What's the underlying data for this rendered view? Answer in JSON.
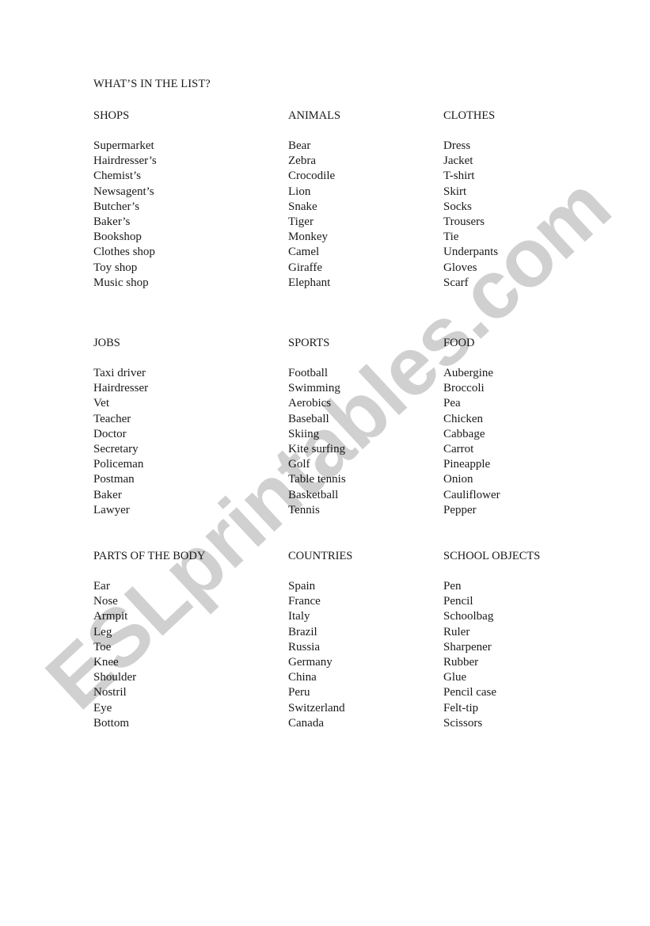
{
  "document": {
    "title": "WHAT’S IN THE LIST?",
    "watermark": "ESLprintables.com",
    "sections": [
      {
        "heading": "SHOPS",
        "items": [
          "Supermarket",
          "Hairdresser’s",
          "Chemist’s",
          "Newsagent’s",
          "Butcher’s",
          "Baker’s",
          "Bookshop",
          "Clothes shop",
          "Toy shop",
          "Music shop"
        ]
      },
      {
        "heading": "ANIMALS",
        "items": [
          "Bear",
          "Zebra",
          "Crocodile",
          "Lion",
          "Snake",
          "Tiger",
          "Monkey",
          "Camel",
          "Giraffe",
          "Elephant"
        ]
      },
      {
        "heading": "CLOTHES",
        "items": [
          "Dress",
          "Jacket",
          "T-shirt",
          "Skirt",
          "Socks",
          "Trousers",
          "Tie",
          "Underpants",
          "Gloves",
          "Scarf"
        ]
      },
      {
        "heading": "JOBS",
        "items": [
          "Taxi driver",
          "Hairdresser",
          "Vet",
          "Teacher",
          "Doctor",
          "Secretary",
          "Policeman",
          "Postman",
          "Baker",
          "Lawyer"
        ]
      },
      {
        "heading": "SPORTS",
        "items": [
          "Football",
          "Swimming",
          "Aerobics",
          "Baseball",
          "Skiing",
          "Kite surfing",
          "Golf",
          "Table tennis",
          "Basketball",
          "Tennis"
        ]
      },
      {
        "heading": "FOOD",
        "items": [
          "Aubergine",
          "Broccoli",
          "Pea",
          "Chicken",
          "Cabbage",
          "Carrot",
          "Pineapple",
          "Onion",
          "Cauliflower",
          "Pepper"
        ]
      },
      {
        "heading": "PARTS OF THE BODY",
        "items": [
          "Ear",
          "Nose",
          "Armpit",
          "Leg",
          "Toe",
          "Knee",
          "Shoulder",
          "Nostril",
          "Eye",
          "Bottom"
        ]
      },
      {
        "heading": "COUNTRIES",
        "items": [
          "Spain",
          "France",
          "Italy",
          "Brazil",
          "Russia",
          "Germany",
          "China",
          "Peru",
          "Switzerland",
          "Canada"
        ]
      },
      {
        "heading": "SCHOOL OBJECTS",
        "items": [
          "Pen",
          "Pencil",
          "Schoolbag",
          "Ruler",
          "Sharpener",
          "Rubber",
          "Glue",
          "Pencil case",
          "Felt-tip",
          "Scissors"
        ]
      }
    ]
  }
}
